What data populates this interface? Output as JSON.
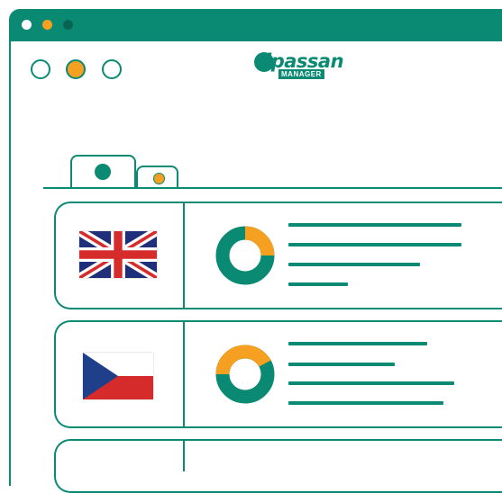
{
  "app": {
    "logo_text": "ipassan",
    "logo_subtext": "MANAGER"
  },
  "colors": {
    "teal": "#0a8a73",
    "orange": "#f5a020",
    "white": "#ffffff"
  },
  "titlebar": {
    "dots": [
      "white",
      "orange",
      "dark-teal"
    ]
  },
  "window_controls": [
    "gray-outline",
    "orange-filled",
    "gray-outline"
  ],
  "tabs": [
    {
      "name": "tab-1",
      "indicator": "teal"
    },
    {
      "name": "tab-2",
      "indicator": "orange"
    }
  ],
  "rows": [
    {
      "flag": "united-kingdom",
      "donut_progress": 0.25
    },
    {
      "flag": "czech-republic",
      "donut_progress": 0.2
    },
    {
      "flag": "",
      "donut_progress": null
    }
  ]
}
